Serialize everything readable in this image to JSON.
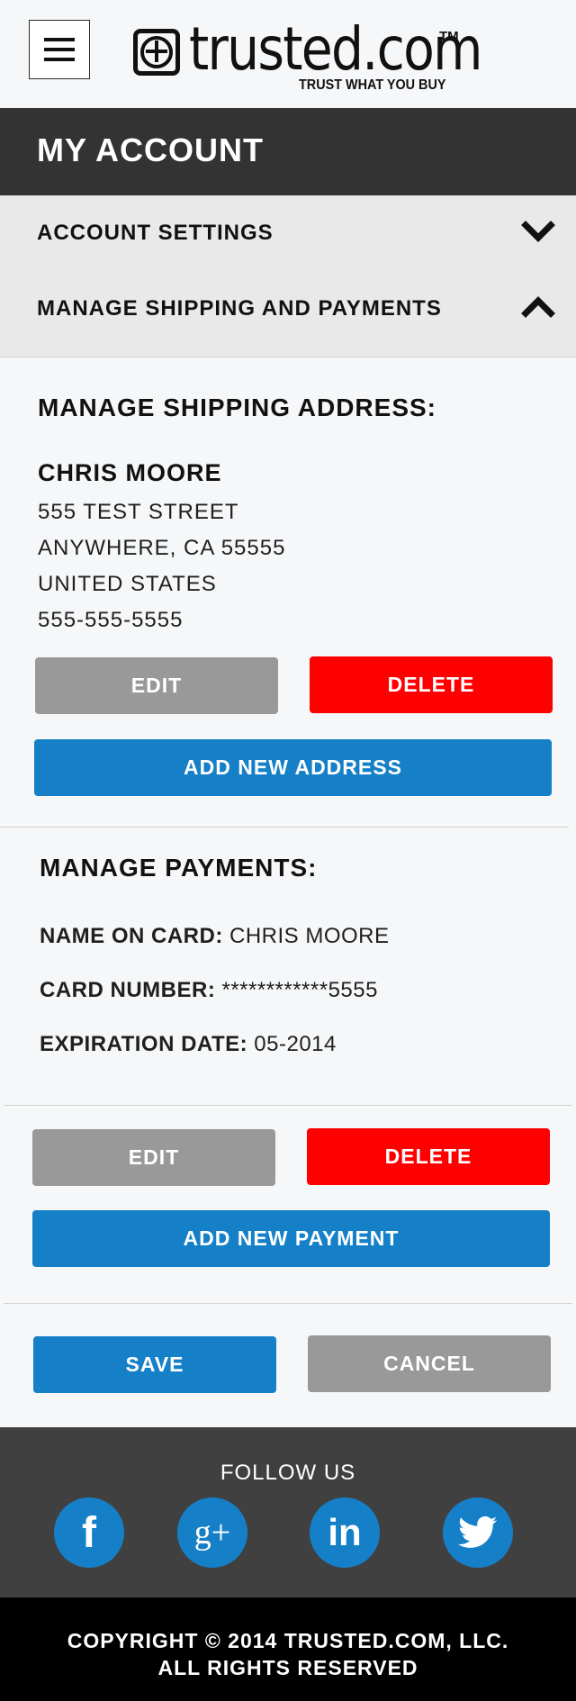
{
  "header": {
    "menu_icon": "hamburger-icon",
    "logo_text": "trusted.com",
    "logo_tm": "TM",
    "logo_tagline": "TRUST WHAT YOU BUY"
  },
  "page_title": "MY ACCOUNT",
  "accordion": {
    "items": [
      {
        "label": "ACCOUNT SETTINGS",
        "icon": "chevron-down-icon",
        "expanded": false
      },
      {
        "label": "MANAGE SHIPPING AND PAYMENTS",
        "icon": "chevron-up-icon",
        "expanded": true
      }
    ]
  },
  "shipping": {
    "title": "MANAGE SHIPPING ADDRESS:",
    "name": "CHRIS MOORE",
    "street": "555 TEST STREET",
    "city_line": "ANYWHERE, CA 55555",
    "country": "UNITED STATES",
    "phone": "555-555-5555",
    "edit_label": "EDIT",
    "delete_label": "DELETE",
    "add_label": "ADD NEW ADDRESS"
  },
  "payments": {
    "title": "MANAGE PAYMENTS:",
    "name_label": "NAME ON CARD:",
    "name_value": "CHRIS MOORE",
    "card_label": "CARD NUMBER:",
    "card_value": "************5555",
    "exp_label": "EXPIRATION DATE:",
    "exp_value": "05-2014",
    "edit_label": "EDIT",
    "delete_label": "DELETE",
    "add_label": "ADD NEW PAYMENT"
  },
  "actions": {
    "save_label": "SAVE",
    "cancel_label": "CANCEL"
  },
  "footer": {
    "follow_title": "FOLLOW US",
    "social": [
      {
        "icon": "facebook-icon",
        "glyph": "f"
      },
      {
        "icon": "google-plus-icon",
        "glyph": "g+"
      },
      {
        "icon": "linkedin-icon",
        "glyph": "in"
      },
      {
        "icon": "twitter-icon",
        "glyph": ""
      }
    ],
    "copyright_line1": "COPYRIGHT © 2014 TRUSTED.COM, LLC.",
    "copyright_line2": "ALL RIGHTS RESERVED"
  },
  "colors": {
    "primary_blue": "#1580c8",
    "delete_red": "#ff0000",
    "neutral_gray": "#999999",
    "title_bar": "#333333",
    "footer_dark": "#404040",
    "footer_black": "#000000"
  }
}
